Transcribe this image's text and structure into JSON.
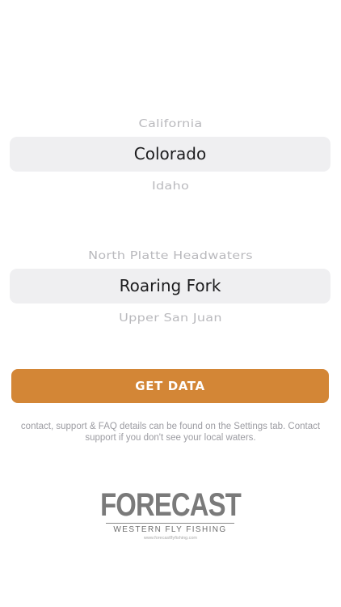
{
  "state_picker": {
    "above": "California",
    "selected": "Colorado",
    "below": "Idaho"
  },
  "water_picker": {
    "above": "North Platte Headwaters",
    "selected": "Roaring Fork",
    "below": "Upper San Juan"
  },
  "get_data_button": {
    "label": "GET DATA"
  },
  "info_text": "contact, support & FAQ details can be found on the Settings tab. Contact support if you don't see your local waters.",
  "logo": {
    "title": "FORECAST",
    "subtitle": "WESTERN FLY FISHING",
    "url": "www.forecastflyfishing.com"
  },
  "colors": {
    "accent": "#d38636",
    "picker_highlight": "#efeff1"
  }
}
